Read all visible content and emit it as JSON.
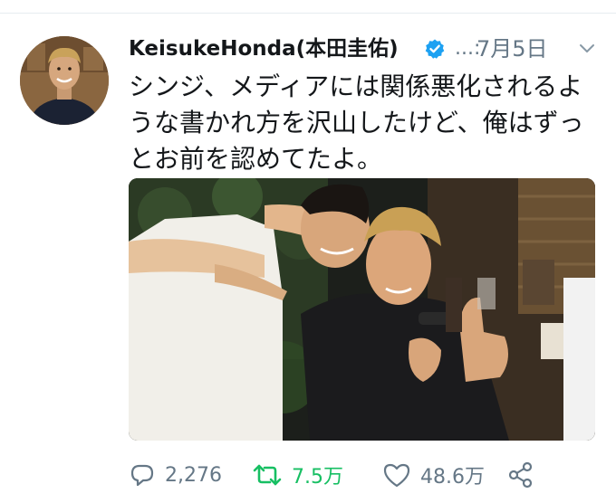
{
  "tweet": {
    "author_name": "KeisukeHonda(本田圭佑)",
    "handle_ellipsis": "...:",
    "timestamp": "7月5日",
    "text_lines": [
      "シンジ、メディアには関係悪化されるよ",
      "うな書かれ方を沢山したけど、俺はずっ",
      "とお前を認めてたよ。"
    ]
  },
  "actions": {
    "reply_count": "2,276",
    "retweet_count": "7.5万",
    "like_count": "48.6万"
  },
  "colors": {
    "verified": "#1da1f2",
    "retweet_active": "#17bf63",
    "secondary_text": "#657786"
  },
  "icons": [
    "chevron-down-icon",
    "verified-icon",
    "reply-icon",
    "retweet-icon",
    "like-icon",
    "share-icon"
  ]
}
